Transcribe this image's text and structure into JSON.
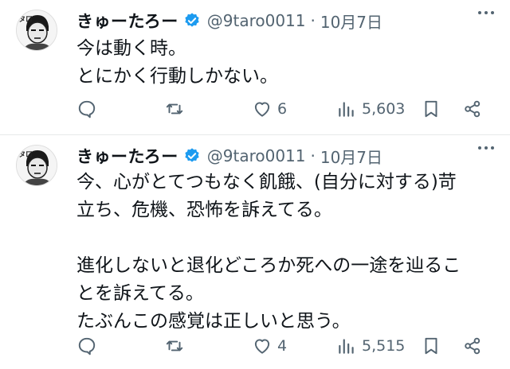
{
  "tweets": [
    {
      "author": {
        "name": "きゅーたろー",
        "handle": "@9taro0011",
        "date": "10月7日",
        "separator": "·"
      },
      "text": "今は動く時。\nとにかく行動しかない。",
      "stats": {
        "replies": "",
        "retweets": "",
        "likes": "6",
        "views": "5,603"
      }
    },
    {
      "author": {
        "name": "きゅーたろー",
        "handle": "@9taro0011",
        "date": "10月7日",
        "separator": "·"
      },
      "text": "今、心がとてつもなく飢餓、(自分に対する)苛\n立ち、危機、恐怖を訴えてる。\n\n進化しないと退化どころか死への一途を辿るこ\nとを訴えてる。\nたぶんこの感覚は正しいと思う。",
      "stats": {
        "replies": "",
        "retweets": "",
        "likes": "4",
        "views": "5,515"
      }
    }
  ],
  "colors": {
    "text": "#0f1419",
    "secondary": "#536471",
    "verified": "#1d9bf0",
    "divider": "#e7e9ea"
  },
  "icons": [
    "avatar",
    "verified-badge-icon",
    "more-icon",
    "reply-icon",
    "retweet-icon",
    "like-icon",
    "views-icon",
    "bookmark-icon",
    "share-icon"
  ]
}
